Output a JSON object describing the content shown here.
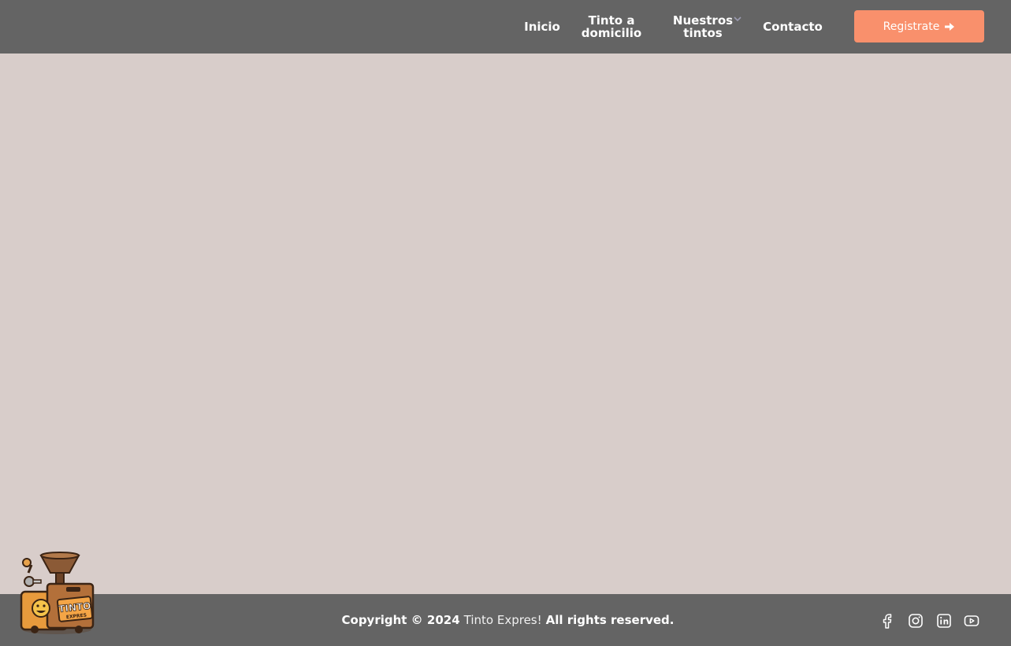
{
  "nav": {
    "items": [
      {
        "label": "Inicio"
      },
      {
        "label": "Tinto a\ndomicilio"
      },
      {
        "label": "Nuestros\ntintos"
      },
      {
        "label": "Contacto"
      }
    ],
    "cta_label": "Registrate"
  },
  "footer": {
    "copyright_prefix": "Copyright © 2024",
    "brand": "Tinto Expres!",
    "copyright_suffix": "All rights reserved.",
    "social": [
      "facebook-icon",
      "instagram-icon",
      "linkedin-icon",
      "youtube-icon"
    ]
  },
  "logo": {
    "text": "TINTO",
    "subtext": "EXPRES"
  },
  "colors": {
    "bar": "#646464",
    "background": "#d8cdca",
    "accent": "#f9906c"
  }
}
